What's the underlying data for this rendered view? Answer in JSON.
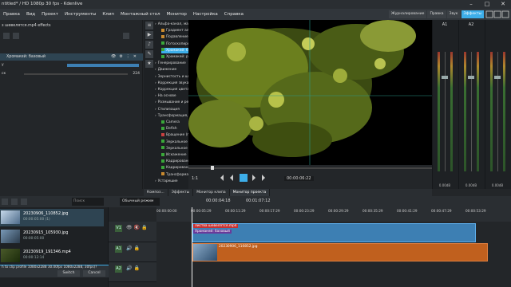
{
  "window": {
    "title": "ntitled* / HD 1080p 30 fps - Kdenlive",
    "controls": [
      "–",
      "□",
      "✕"
    ]
  },
  "menu": [
    "Правка",
    "Вид",
    "Проект",
    "Инструменты",
    "Клип",
    "Монтажный стол",
    "Монитор",
    "Настройка",
    "Справка"
  ],
  "layouts": [
    {
      "label": "Журналирование",
      "active": false
    },
    {
      "label": "Правка",
      "active": false
    },
    {
      "label": "Звук",
      "active": false
    },
    {
      "label": "Эффекты",
      "active": true
    }
  ],
  "effect_stack": {
    "title": "з шевелятся.mp4 effects",
    "effect_name": "Хромакей: базовый",
    "params": [
      {
        "label": "у",
        "value": ""
      },
      {
        "label": "ск",
        "value": "224"
      }
    ]
  },
  "effect_tree": {
    "items": [
      {
        "label": "Альфа-канал, маски и",
        "level": 0,
        "color": ""
      },
      {
        "label": "Градиент альфа",
        "level": 1,
        "color": "#c98a2f"
      },
      {
        "label": "Подавление ра",
        "level": 1,
        "color": "#c98a2f"
      },
      {
        "label": "Потоскопирован",
        "level": 1,
        "color": "#3aa83a"
      },
      {
        "label": "Хромакей: баз",
        "level": 1,
        "color": "#3aa83a",
        "selected": true
      },
      {
        "label": "Хромакей: рас",
        "level": 1,
        "color": "#3aa83a"
      },
      {
        "label": "Генерирование",
        "level": 0,
        "color": ""
      },
      {
        "label": "Движение",
        "level": 0,
        "color": ""
      },
      {
        "label": "Зернистость и шум",
        "level": 0,
        "color": ""
      },
      {
        "label": "Коррекция звука",
        "level": 0,
        "color": ""
      },
      {
        "label": "Коррекция цвета и изо",
        "level": 0,
        "color": ""
      },
      {
        "label": "На основе",
        "level": 0,
        "color": ""
      },
      {
        "label": "Размывание и резкост",
        "level": 0,
        "color": ""
      },
      {
        "label": "Стилизация",
        "level": 0,
        "color": ""
      },
      {
        "label": "Трансформация, иска",
        "level": 0,
        "color": ""
      },
      {
        "label": "Camera",
        "level": 1,
        "color": "#3aa83a"
      },
      {
        "label": "Defish",
        "level": 1,
        "color": "#3aa83a"
      },
      {
        "label": "Вращение (по",
        "level": 1,
        "color": "#c84040"
      },
      {
        "label": "Зеркальное от",
        "level": 1,
        "color": "#3aa83a"
      },
      {
        "label": "Зеркальное от",
        "level": 1,
        "color": "#3aa83a"
      },
      {
        "label": "Искажение",
        "level": 1,
        "color": "#3aa83a"
      },
      {
        "label": "Кадрирование",
        "level": 1,
        "color": "#3aa83a"
      },
      {
        "label": "Кадрирование ди",
        "level": 1,
        "color": "#3aa83a"
      },
      {
        "label": "Трансформац",
        "level": 1,
        "color": "#c98a2f"
      },
      {
        "label": "Устарешие",
        "level": 0,
        "color": ""
      }
    ]
  },
  "monitor": {
    "zoom": "1:1",
    "timecode": "00:00:06:22"
  },
  "mixer": {
    "channels": [
      {
        "label": "A1",
        "db": "0.00dB"
      },
      {
        "label": "A2",
        "db": "0.00dB"
      },
      {
        "label": "",
        "db": "0.00dB"
      }
    ]
  },
  "tabs": [
    {
      "label": "Композ...",
      "active": false
    },
    {
      "label": "Эффекты",
      "active": false
    },
    {
      "label": "Монитор клипа",
      "active": false
    },
    {
      "label": "Монитор проекта",
      "active": true
    }
  ],
  "timeline_toolbar": {
    "search_placeholder": "Поиск",
    "mode": "Обычный режим",
    "position": "00:00:04:18",
    "duration": "00:01:07:12"
  },
  "bin": {
    "clips": [
      {
        "name": "20230906_110852.jpg",
        "duration": "00:00:05:00 (1)",
        "selected": true
      },
      {
        "name": "20230915_105930.jpg",
        "duration": "00:00:05:00",
        "selected": false
      },
      {
        "name": "20230919_191346.mp4",
        "duration": "00:00:12:14",
        "selected": false
      }
    ],
    "switch_message": "h to clip profile 1080x2288 30.00fps 1080x2288, 30fps)?",
    "switch_label": "Switch",
    "cancel_label": "Cancel"
  },
  "timeline": {
    "ticks": [
      "00:00:00:00",
      "00:00:05:29",
      "00:00:11:29",
      "00:00:17:29",
      "00:00:23:29",
      "00:00:29:29",
      "00:00:35:29",
      "00:00:41:29",
      "00:00:47:29",
      "00:00:53:29"
    ],
    "tracks": [
      {
        "label": "V1"
      },
      {
        "label": "A1"
      },
      {
        "label": "A2"
      }
    ],
    "video_clip_title": "листва шевелятся.mp4",
    "video_clip_effect": "Хромакей: базовый",
    "photo_clip": "20230906_110852.jpg"
  },
  "colors": {
    "accent": "#3daee9",
    "audio_clip": "#c0601e",
    "video_clip": "#3d7fb3"
  }
}
